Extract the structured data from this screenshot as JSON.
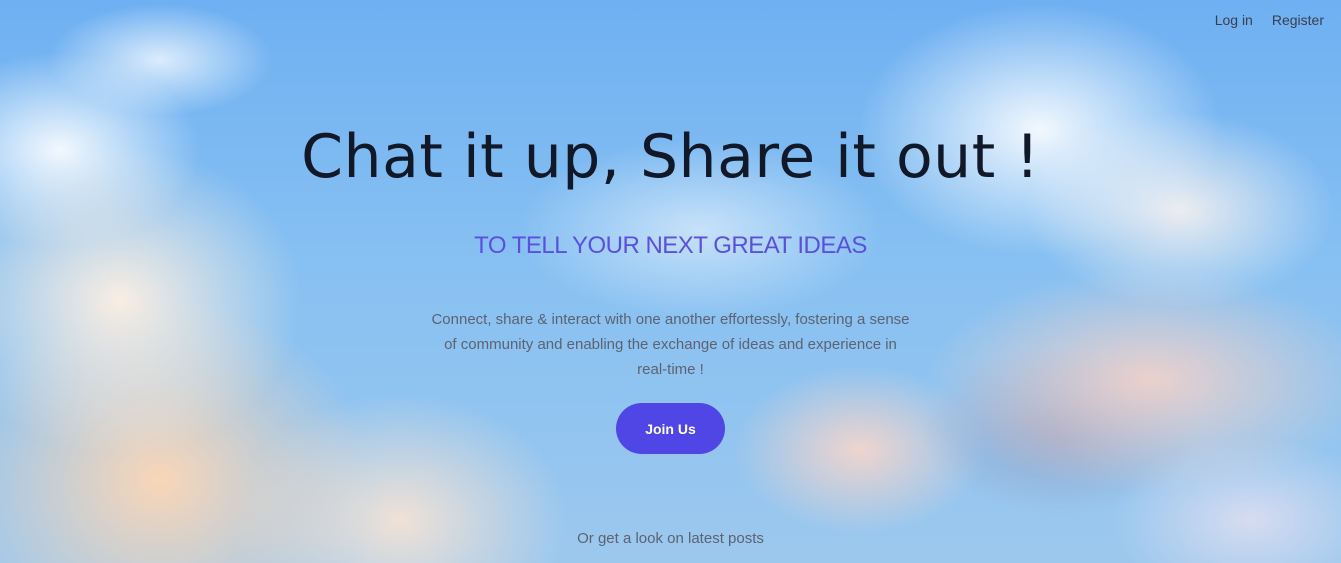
{
  "nav": {
    "login_label": "Log in",
    "register_label": "Register"
  },
  "hero": {
    "title": "Chat it up, Share it out !",
    "subtitle": "TO TELL YOUR NEXT GREAT IDEAS",
    "description": "Connect, share & interact with one another effortessly, fostering a sense of community and enabling the exchange of ideas and experience in real-time !",
    "join_label": "Join Us",
    "latest_posts_label": "Or get a look on latest posts"
  },
  "colors": {
    "accent": "#4f46e5",
    "subtitle": "#5b4fe0",
    "title": "#111827",
    "body_text": "#5d6272"
  }
}
